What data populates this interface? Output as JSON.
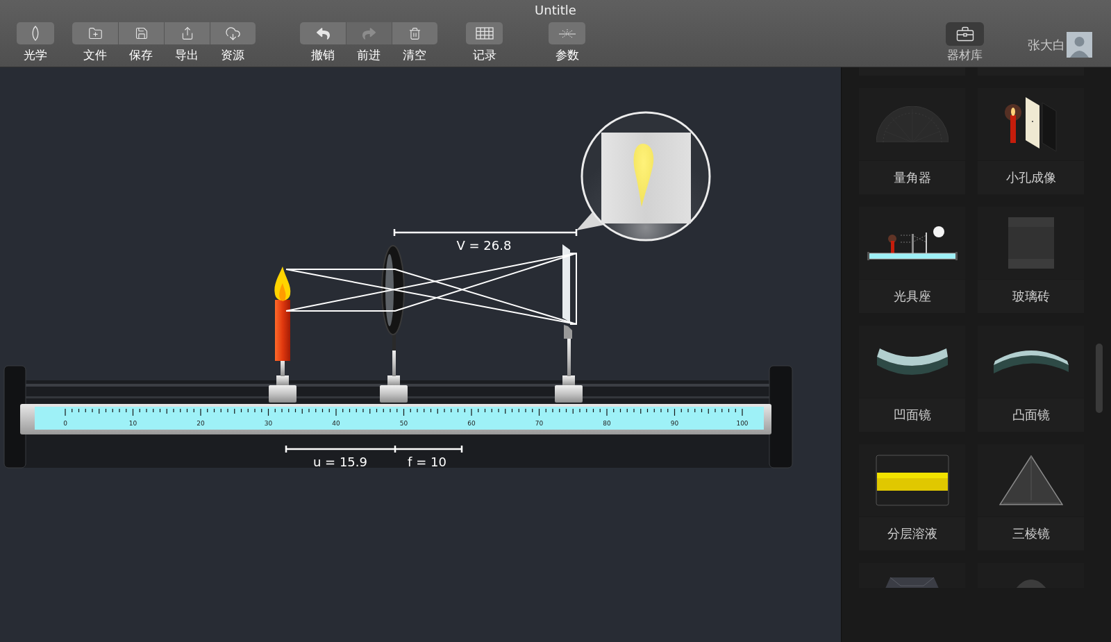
{
  "window": {
    "title": "Untitle"
  },
  "toolbar": {
    "groups": [
      {
        "items": [
          {
            "label": "光学",
            "disabled": false
          }
        ]
      },
      {
        "items": [
          {
            "label": "文件",
            "disabled": false
          },
          {
            "label": "保存",
            "disabled": false
          },
          {
            "label": "导出",
            "disabled": false
          },
          {
            "label": "资源",
            "disabled": false
          }
        ]
      },
      {
        "items": [
          {
            "label": "撤销",
            "disabled": false
          },
          {
            "label": "前进",
            "disabled": true
          },
          {
            "label": "清空",
            "disabled": false
          }
        ]
      },
      {
        "items": [
          {
            "label": "记录",
            "disabled": false
          }
        ]
      },
      {
        "items": [
          {
            "label": "参数",
            "disabled": false
          }
        ]
      }
    ],
    "library_button": {
      "label": "器材库",
      "on": true
    },
    "user": {
      "name": "张大白"
    }
  },
  "canvas": {
    "ruler_labels": [
      "0",
      "10",
      "20",
      "30",
      "40",
      "50",
      "60",
      "70",
      "80",
      "90",
      "100"
    ],
    "image_distance": "V = 26.8",
    "object_distance": "u = 15.9",
    "focal_length": "f = 10"
  },
  "library": {
    "items": [
      {
        "kind": "protractor",
        "label": "量角器"
      },
      {
        "kind": "pinhole",
        "label": "小孔成像"
      },
      {
        "kind": "bench",
        "label": "光具座"
      },
      {
        "kind": "block",
        "label": "玻璃砖"
      },
      {
        "kind": "concave",
        "label": "凹面镜"
      },
      {
        "kind": "convex",
        "label": "凸面镜"
      },
      {
        "kind": "layers",
        "label": "分层溶液"
      },
      {
        "kind": "prism",
        "label": "三棱镜"
      },
      {
        "kind": "gem"
      },
      {
        "kind": "dome"
      }
    ]
  }
}
